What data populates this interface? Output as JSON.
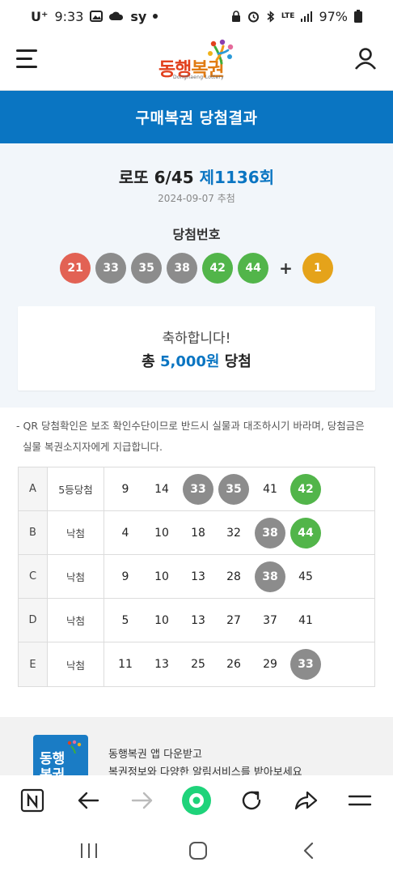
{
  "status_bar": {
    "time": "9:33",
    "carrier": "U⁺",
    "carrier_extra": "sy",
    "battery": "97%",
    "network": "LTE"
  },
  "header": {
    "logo_text_1": "동행",
    "logo_text_2": "복권",
    "logo_sub": "Donghaeng Lottery"
  },
  "page_title": "구매복권 당첨결과",
  "draw": {
    "game": "로또 6/45",
    "round": "제1136회",
    "date": "2024-09-07 추첨",
    "winning_label": "당첨번호",
    "numbers": [
      {
        "n": "21",
        "color": "#e26254"
      },
      {
        "n": "33",
        "color": "#8c8c8c"
      },
      {
        "n": "35",
        "color": "#8c8c8c"
      },
      {
        "n": "38",
        "color": "#8c8c8c"
      },
      {
        "n": "42",
        "color": "#52b54a"
      },
      {
        "n": "44",
        "color": "#52b54a"
      }
    ],
    "plus": "+",
    "bonus": {
      "n": "1",
      "color": "#e5a31a"
    }
  },
  "summary": {
    "congrats": "축하합니다!",
    "total_prefix": "총",
    "total_amount": "5,000원",
    "total_suffix": "당첨"
  },
  "notice": {
    "line1": "- QR 당첨확인은 보조 확인수단이므로 반드시 실물과 대조하시기 바라며, 당첨금은",
    "line2": "실물 복권소지자에게 지급합니다."
  },
  "ticket": [
    {
      "game": "A",
      "rank": "5등당첨",
      "nums": [
        {
          "n": "9"
        },
        {
          "n": "14"
        },
        {
          "n": "33",
          "hit": "gray"
        },
        {
          "n": "35",
          "hit": "gray"
        },
        {
          "n": "41"
        },
        {
          "n": "42",
          "hit": "green"
        }
      ]
    },
    {
      "game": "B",
      "rank": "낙첨",
      "nums": [
        {
          "n": "4"
        },
        {
          "n": "10"
        },
        {
          "n": "18"
        },
        {
          "n": "32"
        },
        {
          "n": "38",
          "hit": "gray"
        },
        {
          "n": "44",
          "hit": "green"
        }
      ]
    },
    {
      "game": "C",
      "rank": "낙첨",
      "nums": [
        {
          "n": "9"
        },
        {
          "n": "10"
        },
        {
          "n": "13"
        },
        {
          "n": "28"
        },
        {
          "n": "38",
          "hit": "gray"
        },
        {
          "n": "45"
        }
      ]
    },
    {
      "game": "D",
      "rank": "낙첨",
      "nums": [
        {
          "n": "5"
        },
        {
          "n": "10"
        },
        {
          "n": "13"
        },
        {
          "n": "27"
        },
        {
          "n": "37"
        },
        {
          "n": "41"
        }
      ]
    },
    {
      "game": "E",
      "rank": "낙첨",
      "nums": [
        {
          "n": "11"
        },
        {
          "n": "13"
        },
        {
          "n": "25"
        },
        {
          "n": "26"
        },
        {
          "n": "29"
        },
        {
          "n": "33",
          "hit": "gray"
        }
      ]
    }
  ],
  "promo": {
    "icon_text": "동행\n복권",
    "line1": "동행복권 앱 다운받고",
    "line2": "복권정보와 다양한 알림서비스를 받아보세요"
  },
  "colors": {
    "brand_blue": "#0a75c2",
    "panel_bg": "#f2f6fa",
    "browser_green": "#1ed37a"
  },
  "icons": [
    "menu-icon",
    "user-icon",
    "naver-icon",
    "back-icon",
    "forward-icon",
    "home-icon",
    "reload-icon",
    "share-icon",
    "tabs-menu-icon"
  ]
}
